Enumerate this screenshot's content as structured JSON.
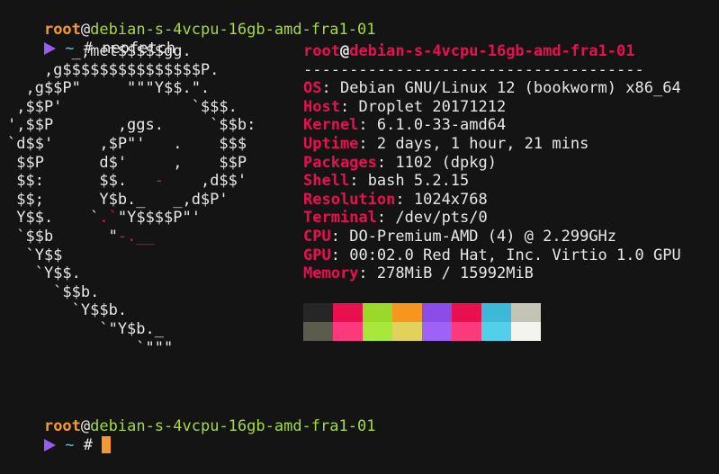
{
  "session": {
    "user": "root",
    "at": "@",
    "host": "debian-s-4vcpu-16gb-amd-fra1-01",
    "tilde": "~",
    "hash": "#",
    "command": "neofetch"
  },
  "ascii_logo": [
    "       _,met$$$$$gg.",
    "    ,g$$$$$$$$$$$$$$$P.",
    "  ,g$$P\"     \"\"\"Y$$.\".",
    " ,$$P'              `$$$.",
    "',$$P       ,ggs.     `$$b:",
    "`d$$'     ,$P\"'   .    $$$",
    " $$P      d$'     ,    $$P",
    " $$:      $$.   -    ,d$$'",
    " $$;      Y$b._   _,d$P'",
    " Y$$.    `.`\"Y$$$$P\"'",
    " `$$b      \"-.__",
    "  `Y$$",
    "   `Y$$.",
    "     `$$b.",
    "       `Y$$b.",
    "          `\"Y$b._",
    "              `\"\"\""
  ],
  "info": {
    "title_user": "root",
    "title_at": "@",
    "title_host": "debian-s-4vcpu-16gb-amd-fra1-01",
    "separator": "-------------------------------------",
    "fields": [
      {
        "key": "OS",
        "value": "Debian GNU/Linux 12 (bookworm) x86_64"
      },
      {
        "key": "Host",
        "value": "Droplet 20171212"
      },
      {
        "key": "Kernel",
        "value": "6.1.0-33-amd64"
      },
      {
        "key": "Uptime",
        "value": "2 days, 1 hour, 21 mins"
      },
      {
        "key": "Packages",
        "value": "1102 (dpkg)"
      },
      {
        "key": "Shell",
        "value": "bash 5.2.15"
      },
      {
        "key": "Resolution",
        "value": "1024x768"
      },
      {
        "key": "Terminal",
        "value": "/dev/pts/0"
      },
      {
        "key": "CPU",
        "value": "DO-Premium-AMD (4) @ 2.299GHz"
      },
      {
        "key": "GPU",
        "value": "00:02.0 Red Hat, Inc. Virtio 1.0 GPU"
      },
      {
        "key": "Memory",
        "value": "278MiB / 15992MiB"
      }
    ],
    "separator_char": ":"
  },
  "palette": {
    "row1": [
      "#262626",
      "#e8104f",
      "#9ad82a",
      "#f7961e",
      "#8a4de8",
      "#e8104f",
      "#3cb8d8",
      "#c4c4b4"
    ],
    "row2": [
      "#5c5c4c",
      "#fb3a7e",
      "#a8e83a",
      "#e0d25a",
      "#9e62f6",
      "#fb3a7e",
      "#52d0ea",
      "#f4f4ee"
    ]
  },
  "icons": {
    "prompt": "prompt-arrow-icon",
    "cursor": "block-cursor"
  }
}
